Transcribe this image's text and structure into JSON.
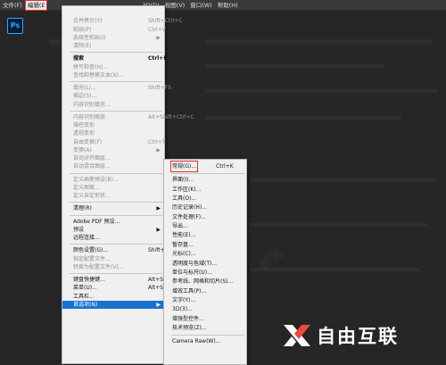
{
  "menubar": {
    "items": [
      "文件(F)",
      "编辑(E",
      "",
      "",
      "",
      "",
      "",
      "",
      "3D(D)",
      "视图(V)",
      "窗口(W)",
      "帮助(H)"
    ]
  },
  "app": {
    "logo": "Ps"
  },
  "edit_menu": {
    "items": [
      {
        "label": "",
        "shortcut": "",
        "disabled": true
      },
      {
        "label": "合并拷贝(Y)",
        "shortcut": "Shift+Ctrl+C",
        "disabled": true
      },
      {
        "label": "粘贴(P)",
        "shortcut": "Ctrl+V",
        "disabled": true
      },
      {
        "label": "选择性粘贴(I)",
        "shortcut": "",
        "disabled": true,
        "submenu": true
      },
      {
        "label": "清除(E)",
        "shortcut": "",
        "disabled": true
      },
      {
        "sep": true
      },
      {
        "label": "搜索",
        "shortcut": "Ctrl+F",
        "disabled": false,
        "bold": true
      },
      {
        "label": "拼写检查(H)...",
        "shortcut": "",
        "disabled": true
      },
      {
        "label": "查找和替换文本(X)...",
        "shortcut": "",
        "disabled": true
      },
      {
        "sep": true
      },
      {
        "label": "填充(L)...",
        "shortcut": "Shift+F5",
        "disabled": true
      },
      {
        "label": "描边(S)...",
        "shortcut": "",
        "disabled": true
      },
      {
        "label": "内容识别填充...",
        "shortcut": "",
        "disabled": true
      },
      {
        "sep": true
      },
      {
        "label": "内容识别缩放",
        "shortcut": "Alt+Shift+Ctrl+C",
        "disabled": true
      },
      {
        "label": "操控变形",
        "shortcut": "",
        "disabled": true
      },
      {
        "label": "透视变形",
        "shortcut": "",
        "disabled": true
      },
      {
        "label": "自由变换(F)",
        "shortcut": "Ctrl+T",
        "disabled": true
      },
      {
        "label": "变换(A)",
        "shortcut": "",
        "disabled": true,
        "submenu": true
      },
      {
        "label": "自动对齐图层...",
        "shortcut": "",
        "disabled": true
      },
      {
        "label": "自动混合图层...",
        "shortcut": "",
        "disabled": true
      },
      {
        "sep": true
      },
      {
        "label": "定义画笔预设(B)...",
        "shortcut": "",
        "disabled": true
      },
      {
        "label": "定义图案...",
        "shortcut": "",
        "disabled": true
      },
      {
        "label": "定义自定形状...",
        "shortcut": "",
        "disabled": true
      },
      {
        "sep": true
      },
      {
        "label": "清理(R)",
        "shortcut": "",
        "disabled": false,
        "submenu": true
      },
      {
        "sep": true
      },
      {
        "label": "Adobe PDF 预设...",
        "shortcut": "",
        "disabled": false
      },
      {
        "label": "预设",
        "shortcut": "",
        "disabled": false,
        "submenu": true
      },
      {
        "label": "远程连接...",
        "shortcut": "",
        "disabled": false
      },
      {
        "sep": true
      },
      {
        "label": "颜色设置(G)...",
        "shortcut": "Shift+Ctrl+K",
        "disabled": false
      },
      {
        "label": "指定配置文件...",
        "shortcut": "",
        "disabled": true
      },
      {
        "label": "转换为配置文件(V)...",
        "shortcut": "",
        "disabled": true
      },
      {
        "sep": true
      },
      {
        "label": "键盘快捷键...",
        "shortcut": "Alt+Shift+Ctrl+K",
        "disabled": false
      },
      {
        "label": "菜单(U)...",
        "shortcut": "Alt+Shift+Ctrl+M",
        "disabled": false
      },
      {
        "label": "工具栏...",
        "shortcut": "",
        "disabled": false
      },
      {
        "label": "首选项(N)",
        "shortcut": "",
        "disabled": false,
        "submenu": true,
        "selected": true
      }
    ]
  },
  "prefs_menu": {
    "items": [
      {
        "label": "常规(G)...",
        "shortcut": "Ctrl+K",
        "boxed": true
      },
      {
        "sep": true
      },
      {
        "label": "界面(I)..."
      },
      {
        "label": "工作区(K)..."
      },
      {
        "label": "工具(O)..."
      },
      {
        "label": "历史记录(H)..."
      },
      {
        "label": "文件处理(F)..."
      },
      {
        "label": "导出..."
      },
      {
        "label": "性能(E)..."
      },
      {
        "label": "暂存盘..."
      },
      {
        "label": "光标(C)..."
      },
      {
        "label": "透明度与色域(T)..."
      },
      {
        "label": "单位与标尺(U)..."
      },
      {
        "label": "参考线、网格和切片(S)..."
      },
      {
        "label": "增效工具(P)..."
      },
      {
        "label": "文字(Y)..."
      },
      {
        "label": "3D(3)..."
      },
      {
        "label": "增强型控件..."
      },
      {
        "label": "技术预览(Z)..."
      },
      {
        "sep": true
      },
      {
        "label": "Camera Raw(W)..."
      }
    ]
  },
  "watermark": {
    "brand": "自由互联"
  },
  "colors": {
    "selected": "#1873d0",
    "highlight": "#e03030",
    "menu_bg": "#f0f0f0",
    "app_bg": "#262626"
  }
}
